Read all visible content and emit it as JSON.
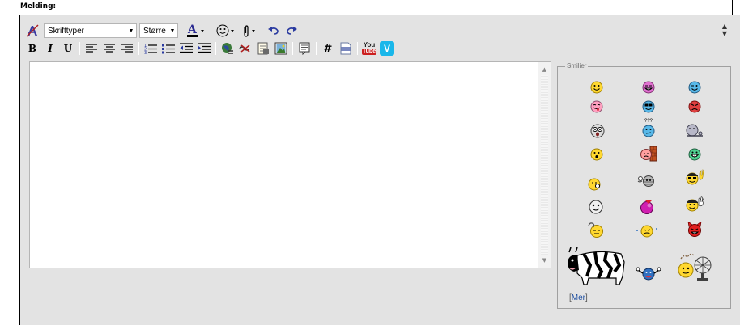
{
  "field_label": "Melding:",
  "toolbar": {
    "font_select": "Skrifttyper",
    "size_select": "Større",
    "row1_icons": [
      "remove-format-icon",
      "font-color-icon",
      "smiley-icon",
      "attachment-icon",
      "undo-icon",
      "redo-icon"
    ],
    "row2": {
      "bold": "B",
      "italic": "I",
      "underline": "U",
      "code_hash": "#",
      "php": "php",
      "youtube_top": "You",
      "youtube_bottom": "Tube",
      "vimeo": "V"
    },
    "colors": {
      "accent_blue": "#2a4aa0",
      "youtube_red": "#cc2020",
      "vimeo_teal": "#1ab7ea"
    }
  },
  "smilies": {
    "legend": "Smilier",
    "rows": [
      [
        "smile",
        "grin-pink",
        "wink-blue"
      ],
      [
        "tongue",
        "cool",
        "angry"
      ],
      [
        "shocked",
        "confused-question",
        "dizzy"
      ],
      [
        "surprised",
        "wall-bang",
        "big-grin-green"
      ],
      [
        "whistle",
        "mummy",
        "rock-on"
      ],
      [
        "happy",
        "kiss",
        "wave"
      ],
      [
        "sleepy",
        "flying",
        "devil"
      ],
      [
        "cow-shit",
        "hug",
        "fan"
      ]
    ],
    "question_marks": "???",
    "more_bracket_open": "[",
    "more_link": "Mer",
    "more_bracket_close": "]"
  }
}
